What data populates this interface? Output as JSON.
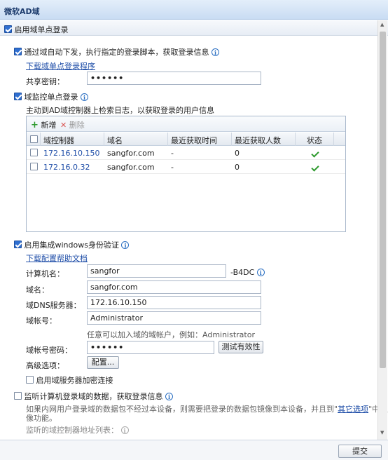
{
  "window": {
    "title": "微软AD域"
  },
  "main_toggle": {
    "label": "启用域单点登录",
    "checked": true
  },
  "section1": {
    "label": "通过域自动下发，执行指定的登录脚本，获取登录信息",
    "download_link": "下载域单点登录程序",
    "shared_key_label": "共享密钥：",
    "shared_key_value": "••••••"
  },
  "section2": {
    "label": "域监控单点登录",
    "description": "主动到AD域控制器上检索日志，以获取登录的用户信息",
    "toolbar": {
      "add": "新增",
      "delete": "删除"
    },
    "columns": [
      "域控制器",
      "域名",
      "最近获取时间",
      "最近获取人数",
      "状态"
    ],
    "rows": [
      {
        "controller": "172.16.10.150",
        "domain": "sangfor.com",
        "last_time": "-",
        "count": "0"
      },
      {
        "controller": "172.16.0.32",
        "domain": "sangfor.com",
        "last_time": "-",
        "count": "0"
      }
    ]
  },
  "section3": {
    "label": "启用集成windows身份验证",
    "help_link": "下载配置帮助文档",
    "computer_name_label": "计算机名：",
    "computer_name_value": "sangfor",
    "computer_suffix": "-B4DC",
    "domain_label": "域名：",
    "domain_value": "sangfor.com",
    "dns_label": "域DNS服务器：",
    "dns_value": "172.16.10.150",
    "account_label": "域帐号：",
    "account_value": "Administrator",
    "account_hint": "任意可以加入域的域帐户，例如：Administrator",
    "password_label": "域帐号密码：",
    "password_value": "••••••",
    "test_button": "测试有效性",
    "advanced_label": "高级选项：",
    "config_button": "配置...",
    "encrypt_label": "启用域服务器加密连接"
  },
  "section4": {
    "label": "监听计算机登录域的数据，获取登录信息",
    "desc_part1": "如果内网用户登录域的数据包不经过本设备，则需要把登录的数据包镜像到本设备，并且到\"",
    "desc_link": "其它选项",
    "desc_part2": "\"中启用镜",
    "desc_line2": "像功能。",
    "listen_label": "监听的域控制器地址列表："
  },
  "footer": {
    "submit": "提交"
  }
}
